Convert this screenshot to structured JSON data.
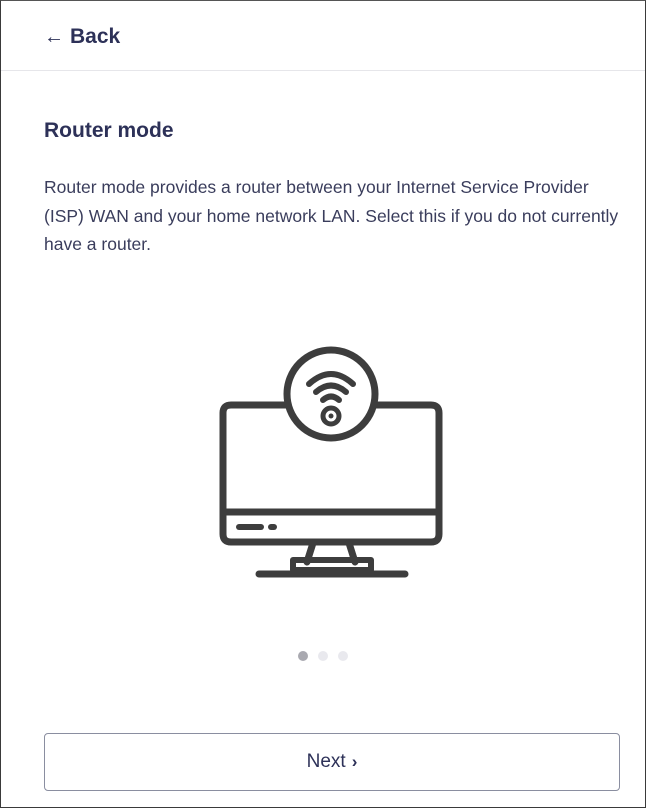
{
  "header": {
    "back_label": "Back",
    "back_icon": "arrow-left-icon"
  },
  "content": {
    "title": "Router mode",
    "description": "Router mode provides a router between your Internet Service Provider (ISP) WAN and your home network LAN. Select this if you do not currently have a router.",
    "illustration_icon": "monitor-wifi-icon"
  },
  "pagination": {
    "total": 3,
    "active_index": 0
  },
  "footer": {
    "next_label": "Next",
    "next_icon": "chevron-right-icon"
  },
  "colors": {
    "text_primary": "#2d3158",
    "text_body": "#3a3d5c",
    "dot_active": "#a9a9b0",
    "dot_inactive": "#e9e9ee",
    "illustration_stroke": "#3d3d3d"
  }
}
